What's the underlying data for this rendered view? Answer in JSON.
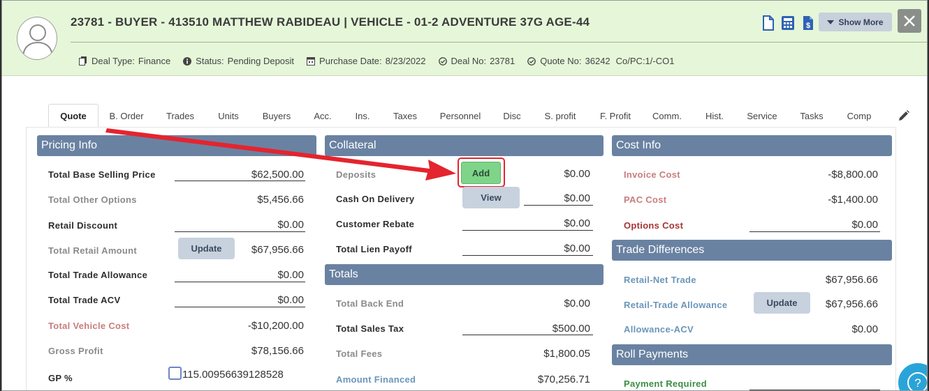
{
  "header": {
    "title": "23781 - BUYER - 413510 MATTHEW RABIDEAU | VEHICLE - 01-2 ADVENTURE 37G AGE-44",
    "meta": {
      "deal_type_label": "Deal Type:",
      "deal_type_value": "Finance",
      "status_label": "Status:",
      "status_value": "Pending Deposit",
      "purchase_date_label": "Purchase Date:",
      "purchase_date_value": "8/23/2022",
      "deal_no_label": "Deal No:",
      "deal_no_value": "23781",
      "quote_no_label": "Quote No:",
      "quote_no_value": "36242",
      "copc": "Co/PC:1/-CO1"
    },
    "show_more_label": "Show More"
  },
  "tabs": [
    "Quote",
    "B. Order",
    "Trades",
    "Units",
    "Buyers",
    "Acc.",
    "Ins.",
    "Taxes",
    "Personnel",
    "Disc",
    "S. profit",
    "F. Profit",
    "Comm.",
    "Hist.",
    "Service",
    "Tasks",
    "Comp"
  ],
  "active_tab": "Quote",
  "pricing": {
    "title": "Pricing Info",
    "total_base_selling_price_label": "Total Base Selling Price",
    "total_base_selling_price": "$62,500.00",
    "total_other_options_label": "Total Other Options",
    "total_other_options": "$5,456.66",
    "retail_discount_label": "Retail Discount",
    "retail_discount": "$0.00",
    "total_retail_amount_label": "Total Retail Amount",
    "total_retail_amount": "$67,956.66",
    "update_label": "Update",
    "total_trade_allowance_label": "Total Trade Allowance",
    "total_trade_allowance": "$0.00",
    "total_trade_acv_label": "Total Trade ACV",
    "total_trade_acv": "$0.00",
    "total_vehicle_cost_label": "Total Vehicle Cost",
    "total_vehicle_cost": "-$10,200.00",
    "gross_profit_label": "Gross Profit",
    "gross_profit": "$78,156.66",
    "gp_percent_label": "GP %",
    "gp_percent": "115.00956639128528"
  },
  "collateral": {
    "title": "Collateral",
    "deposits_label": "Deposits",
    "deposits": "$0.00",
    "add_label": "Add",
    "cash_on_delivery_label": "Cash On Delivery",
    "cash_on_delivery": "$0.00",
    "view_label": "View",
    "customer_rebate_label": "Customer Rebate",
    "customer_rebate": "$0.00",
    "total_lien_payoff_label": "Total Lien Payoff",
    "total_lien_payoff": "$0.00"
  },
  "totals": {
    "title": "Totals",
    "total_back_end_label": "Total Back End",
    "total_back_end": "$0.00",
    "total_sales_tax_label": "Total Sales Tax",
    "total_sales_tax": "$500.00",
    "total_fees_label": "Total Fees",
    "total_fees": "$1,800.05",
    "amount_financed_label": "Amount Financed",
    "amount_financed": "$70,256.71"
  },
  "cost_info": {
    "title": "Cost Info",
    "invoice_cost_label": "Invoice Cost",
    "invoice_cost": "-$8,800.00",
    "pac_cost_label": "PAC Cost",
    "pac_cost": "-$1,400.00",
    "options_cost_label": "Options Cost",
    "options_cost": "$0.00"
  },
  "trade_differences": {
    "title": "Trade Differences",
    "retail_net_trade_label": "Retail-Net Trade",
    "retail_net_trade": "$67,956.66",
    "retail_trade_allowance_label": "Retail-Trade Allowance",
    "retail_trade_allowance": "$67,956.66",
    "update_label": "Update",
    "allowance_acv_label": "Allowance-ACV",
    "allowance_acv": "$0.00"
  },
  "roll_payments": {
    "title": "Roll Payments",
    "payment_required_label": "Payment Required"
  },
  "colors": {
    "header_bg": "#e5f7d8",
    "section_header": "#6a82a2",
    "add_button": "#7ed58a",
    "annotation_arrow": "#e4242e",
    "help_button": "#2aa4d8"
  }
}
